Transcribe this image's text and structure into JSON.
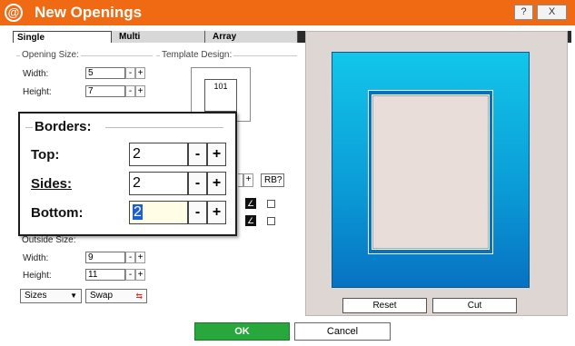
{
  "window": {
    "title": "New Openings",
    "logo_glyph": "@",
    "help_label": "?",
    "close_label": "X",
    "titlebar_color": "#f06a14"
  },
  "tabs": [
    {
      "label": "Single",
      "active": true
    },
    {
      "label": "Multi",
      "active": false
    },
    {
      "label": "Array",
      "active": false
    }
  ],
  "opening_size": {
    "legend": "Opening Size:",
    "width_label": "Width:",
    "width_value": "5",
    "height_label": "Height:",
    "height_value": "7",
    "sizes_label": "Sizes",
    "swap_label": "Swap"
  },
  "template_design": {
    "legend": "Template Design:",
    "value": "101"
  },
  "spinner": {
    "minus": "-",
    "plus": "+"
  },
  "rb_label": "RB?",
  "pen_glyph": "∠",
  "outside_size": {
    "legend": "Outside Size:",
    "width_label": "Width:",
    "width_value": "9",
    "height_label": "Height:",
    "height_value": "11",
    "sizes_label": "Sizes",
    "swap_label": "Swap"
  },
  "borders_popup": {
    "legend": "Borders:",
    "top_label": "Top:",
    "top_value": "2",
    "sides_label": "Sides:",
    "sides_value": "2",
    "bottom_label": "Bottom:",
    "bottom_value": "2"
  },
  "preview": {
    "mat_color": "#0a9ad6",
    "reset_label": "Reset",
    "cut_label": "Cut"
  },
  "footer": {
    "ok_label": "OK",
    "cancel_label": "Cancel",
    "ok_color": "#28a83c"
  }
}
